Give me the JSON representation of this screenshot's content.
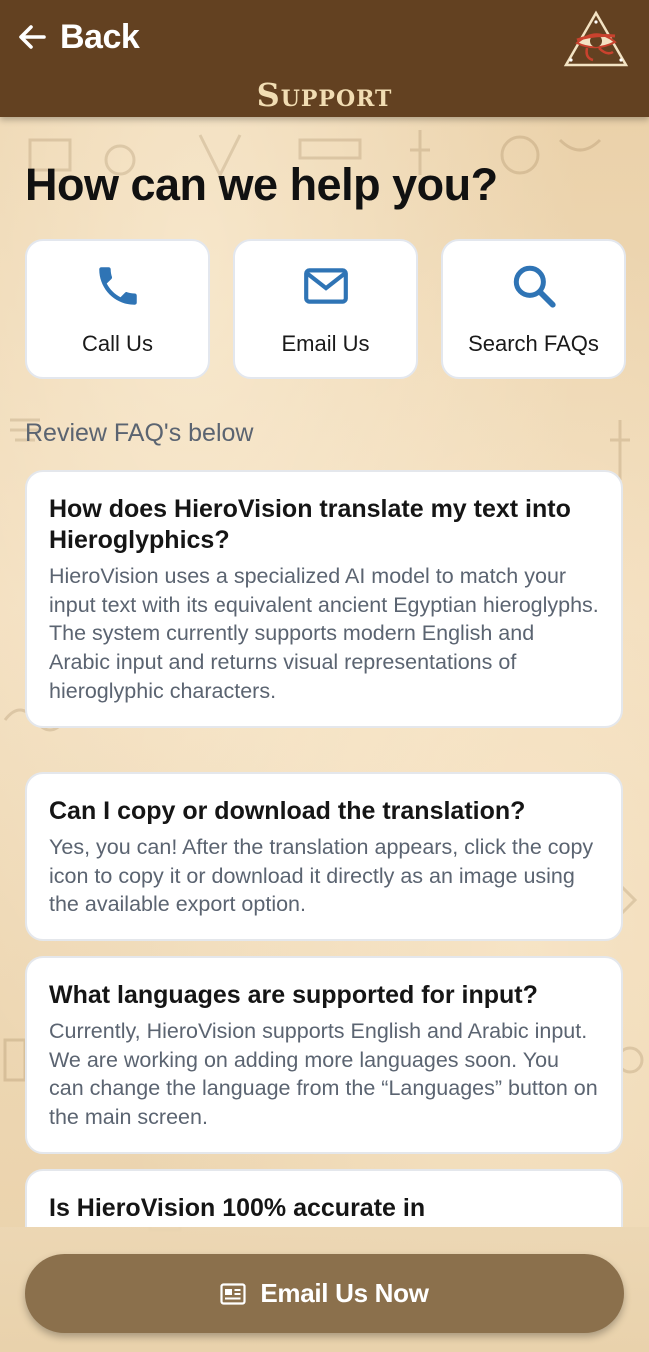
{
  "header": {
    "back_label": "Back",
    "title": "Support",
    "logo_icon": "eye-of-ra-logo"
  },
  "main": {
    "headline": "How can we help you?",
    "actions": [
      {
        "label": "Call Us",
        "icon": "phone-icon"
      },
      {
        "label": "Email Us",
        "icon": "envelope-icon"
      },
      {
        "label": "Search FAQs",
        "icon": "search-icon"
      }
    ],
    "faq_label": "Review FAQ's below",
    "faqs": [
      {
        "question": "How does HieroVision translate my text into Hieroglyphics?",
        "answer": "HieroVision uses a specialized AI model to match your input text with its equivalent ancient Egyptian hieroglyphs. The system currently supports modern English and Arabic input and returns visual representations of hieroglyphic characters."
      },
      {
        "question": "Can I copy or download the translation?",
        "answer": "Yes, you can! After the translation appears, click the copy icon to copy it or download it directly as an image using the available export option."
      },
      {
        "question": "What languages are supported for input?",
        "answer": "Currently, HieroVision supports English and Arabic input. We are working on adding more languages soon. You can change the language from the “Languages” button on the main screen."
      },
      {
        "question": "Is HieroVision 100% accurate in",
        "answer": ""
      }
    ]
  },
  "cta": {
    "label": "Email Us Now",
    "icon": "contact-card-icon"
  },
  "colors": {
    "header_bg": "#634121",
    "title_color": "#f1ddb3",
    "accent_blue": "#2f74b5",
    "cta_bg": "#8b704c",
    "parchment": "#ecd7b4"
  }
}
